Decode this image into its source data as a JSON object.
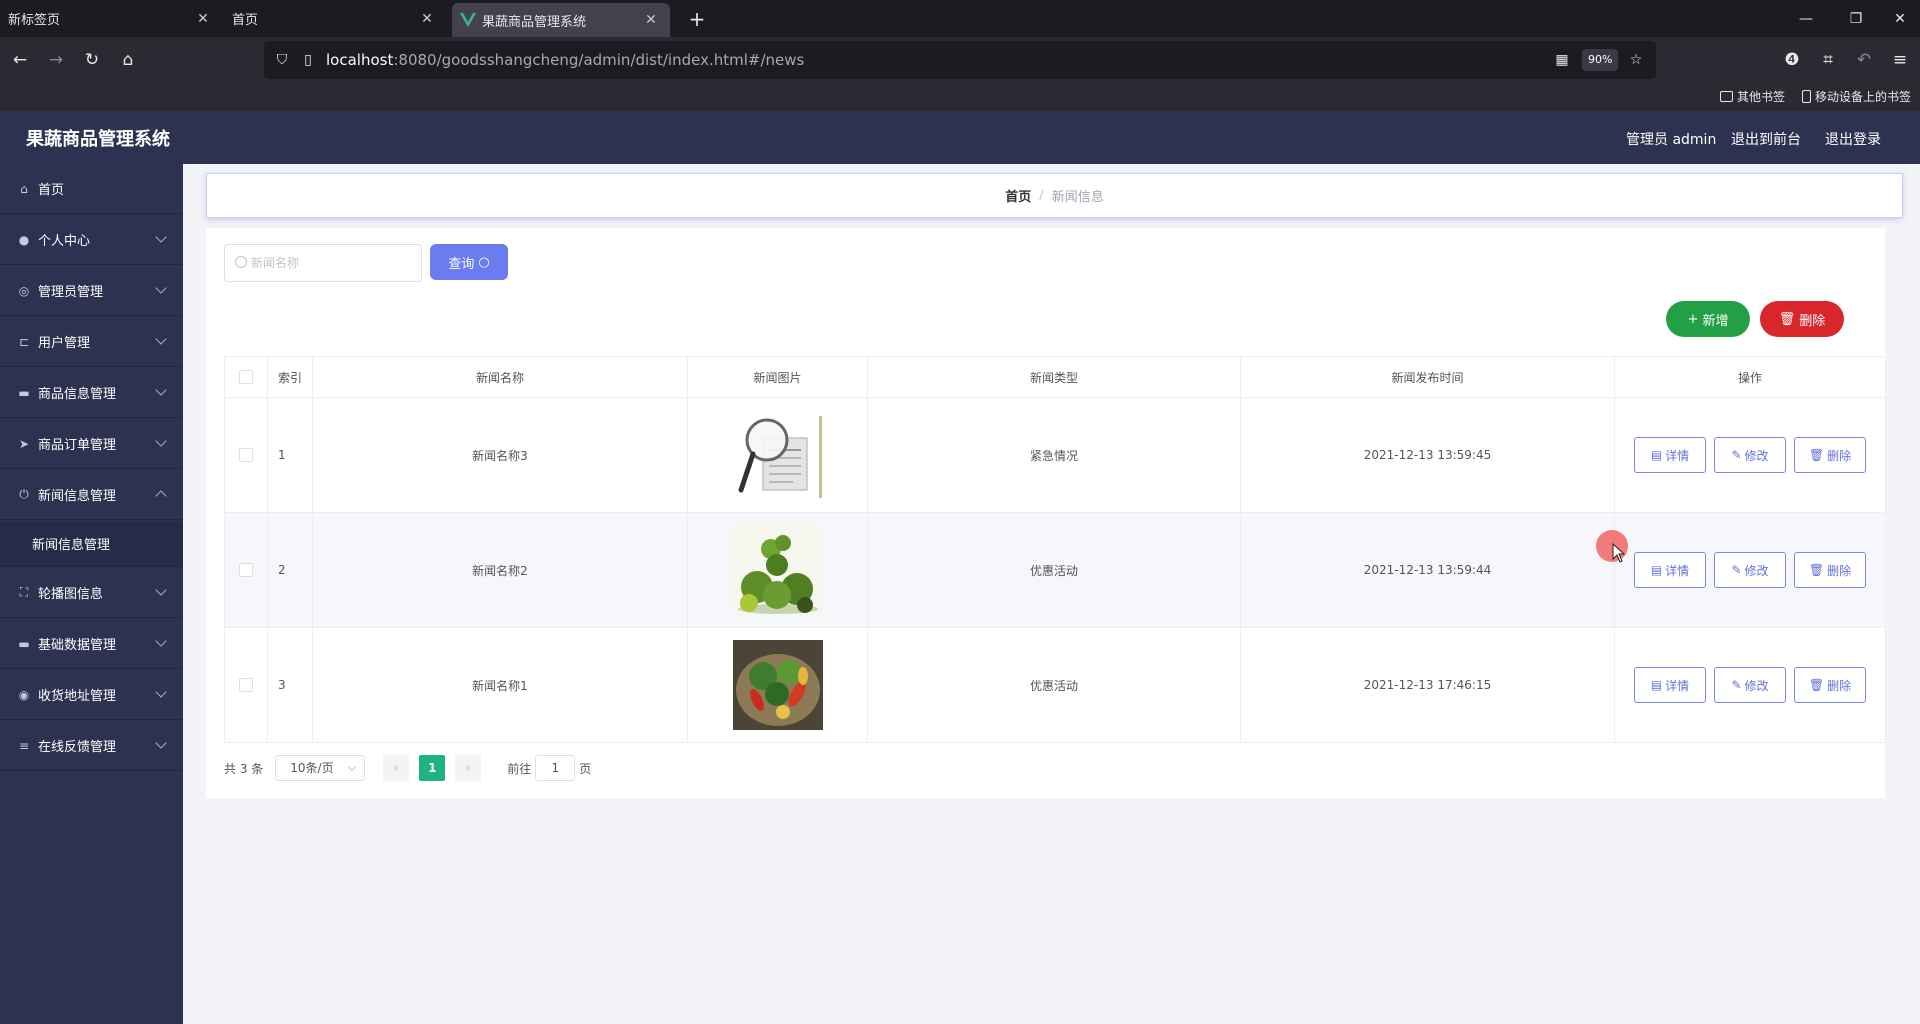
{
  "browser": {
    "tabs": [
      {
        "label": "新标签页",
        "close": "✕"
      },
      {
        "label": "首页",
        "close": "✕"
      },
      {
        "label": "果蔬商品管理系统",
        "close": "✕"
      }
    ],
    "new_tab": "+",
    "window_controls": {
      "minimize": "—",
      "restore": "❐",
      "close": "✕"
    },
    "url_host": "localhost",
    "url_rest": ":8080/goodsshangcheng/admin/dist/index.html#/news",
    "zoom": "90%",
    "bookmarks": [
      {
        "label": "其他书签",
        "icon": "folder-icon"
      },
      {
        "label": "移动设备上的书签",
        "icon": "mobile-icon"
      }
    ]
  },
  "header": {
    "title": "果蔬商品管理系统",
    "user": "管理员 admin",
    "front": "退出到前台",
    "logout": "退出登录"
  },
  "sidebar": {
    "items": [
      {
        "label": "首页",
        "icon": "home-icon",
        "glyph": "⌂"
      },
      {
        "label": "个人中心",
        "icon": "user-icon",
        "glyph": "●"
      },
      {
        "label": "管理员管理",
        "icon": "globe-icon",
        "glyph": "◎"
      },
      {
        "label": "用户管理",
        "icon": "crop-icon",
        "glyph": "⊏"
      },
      {
        "label": "商品信息管理",
        "icon": "card-icon",
        "glyph": "▬"
      },
      {
        "label": "商品订单管理",
        "icon": "send-icon",
        "glyph": "➤"
      },
      {
        "label": "新闻信息管理",
        "icon": "power-icon",
        "glyph": "⏻"
      },
      {
        "label": "轮播图信息",
        "icon": "fullscreen-icon",
        "glyph": "⛶"
      },
      {
        "label": "基础数据管理",
        "icon": "chat-icon",
        "glyph": "▬"
      },
      {
        "label": "收货地址管理",
        "icon": "compass-icon",
        "glyph": "◉"
      },
      {
        "label": "在线反馈管理",
        "icon": "menu-icon",
        "glyph": "≡"
      }
    ],
    "submenu": {
      "label": "新闻信息管理"
    }
  },
  "breadcrumb": {
    "home": "首页",
    "separator": "/",
    "current": "新闻信息"
  },
  "search": {
    "placeholder": "新闻名称",
    "value": "",
    "button": "查询"
  },
  "actions": {
    "add": "新增",
    "delete": "删除"
  },
  "table": {
    "columns": [
      "索引",
      "新闻名称",
      "新闻图片",
      "新闻类型",
      "新闻发布时间",
      "操作"
    ],
    "rows": [
      {
        "index": "1",
        "name": "新闻名称3",
        "image": "news-magnifier-image",
        "type": "紧急情况",
        "time": "2021-12-13 13:59:45"
      },
      {
        "index": "2",
        "name": "新闻名称2",
        "image": "broccoli-image",
        "type": "优惠活动",
        "time": "2021-12-13 13:59:44"
      },
      {
        "index": "3",
        "name": "新闻名称1",
        "image": "vegetable-basket-image",
        "type": "优惠活动",
        "time": "2021-12-13 17:46:15"
      }
    ],
    "row_actions": {
      "detail": "详情",
      "edit": "修改",
      "delete": "删除"
    }
  },
  "pagination": {
    "total": "共 3 条",
    "page_size": "10条/页",
    "prev": "‹",
    "current": "1",
    "next": "›",
    "goto_label": "前往",
    "goto_value": "1",
    "goto_suffix": "页"
  },
  "colors": {
    "header_bg": "#2d3250",
    "primary": "#6b7cf0",
    "success": "#23a045",
    "danger": "#d9262b",
    "page_active": "#1fb37e"
  }
}
